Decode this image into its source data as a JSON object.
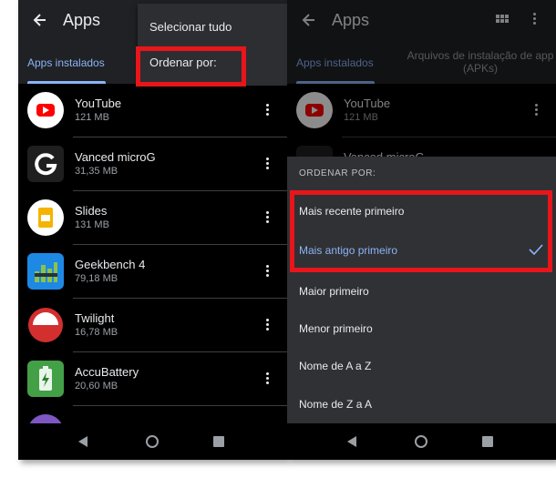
{
  "left": {
    "title": "Apps",
    "tab_installed": "Apps instalados",
    "menu": {
      "select_all": "Selecionar tudo",
      "sort_by": "Ordenar por:"
    },
    "apps": [
      {
        "name": "YouTube",
        "size": "121 MB",
        "icon": "youtube-icon"
      },
      {
        "name": "Vanced microG",
        "size": "31,35 MB",
        "icon": "vanced-microg-icon"
      },
      {
        "name": "Slides",
        "size": "131 MB",
        "icon": "slides-icon"
      },
      {
        "name": "Geekbench 4",
        "size": "79,18 MB",
        "icon": "geekbench-icon"
      },
      {
        "name": "Twilight",
        "size": "16,78 MB",
        "icon": "twilight-icon"
      },
      {
        "name": "AccuBattery",
        "size": "20,60 MB",
        "icon": "accubattery-icon"
      }
    ]
  },
  "right": {
    "title": "Apps",
    "tab_installed": "Apps instalados",
    "tab_apks": "Arquivos de instalação de app (APKs)",
    "apps": [
      {
        "name": "YouTube",
        "size": "121 MB"
      },
      {
        "name": "Vanced microG"
      }
    ],
    "sheet": {
      "header": "ORDENAR POR:",
      "options": [
        "Mais recente primeiro",
        "Mais antigo primeiro",
        "Maior primeiro",
        "Menor primeiro",
        "Nome de A a Z",
        "Nome de Z a A"
      ],
      "selected_index": 1
    }
  },
  "colors": {
    "accent": "#8ab4f8",
    "highlight": "#e8151b",
    "background": "#202124"
  }
}
